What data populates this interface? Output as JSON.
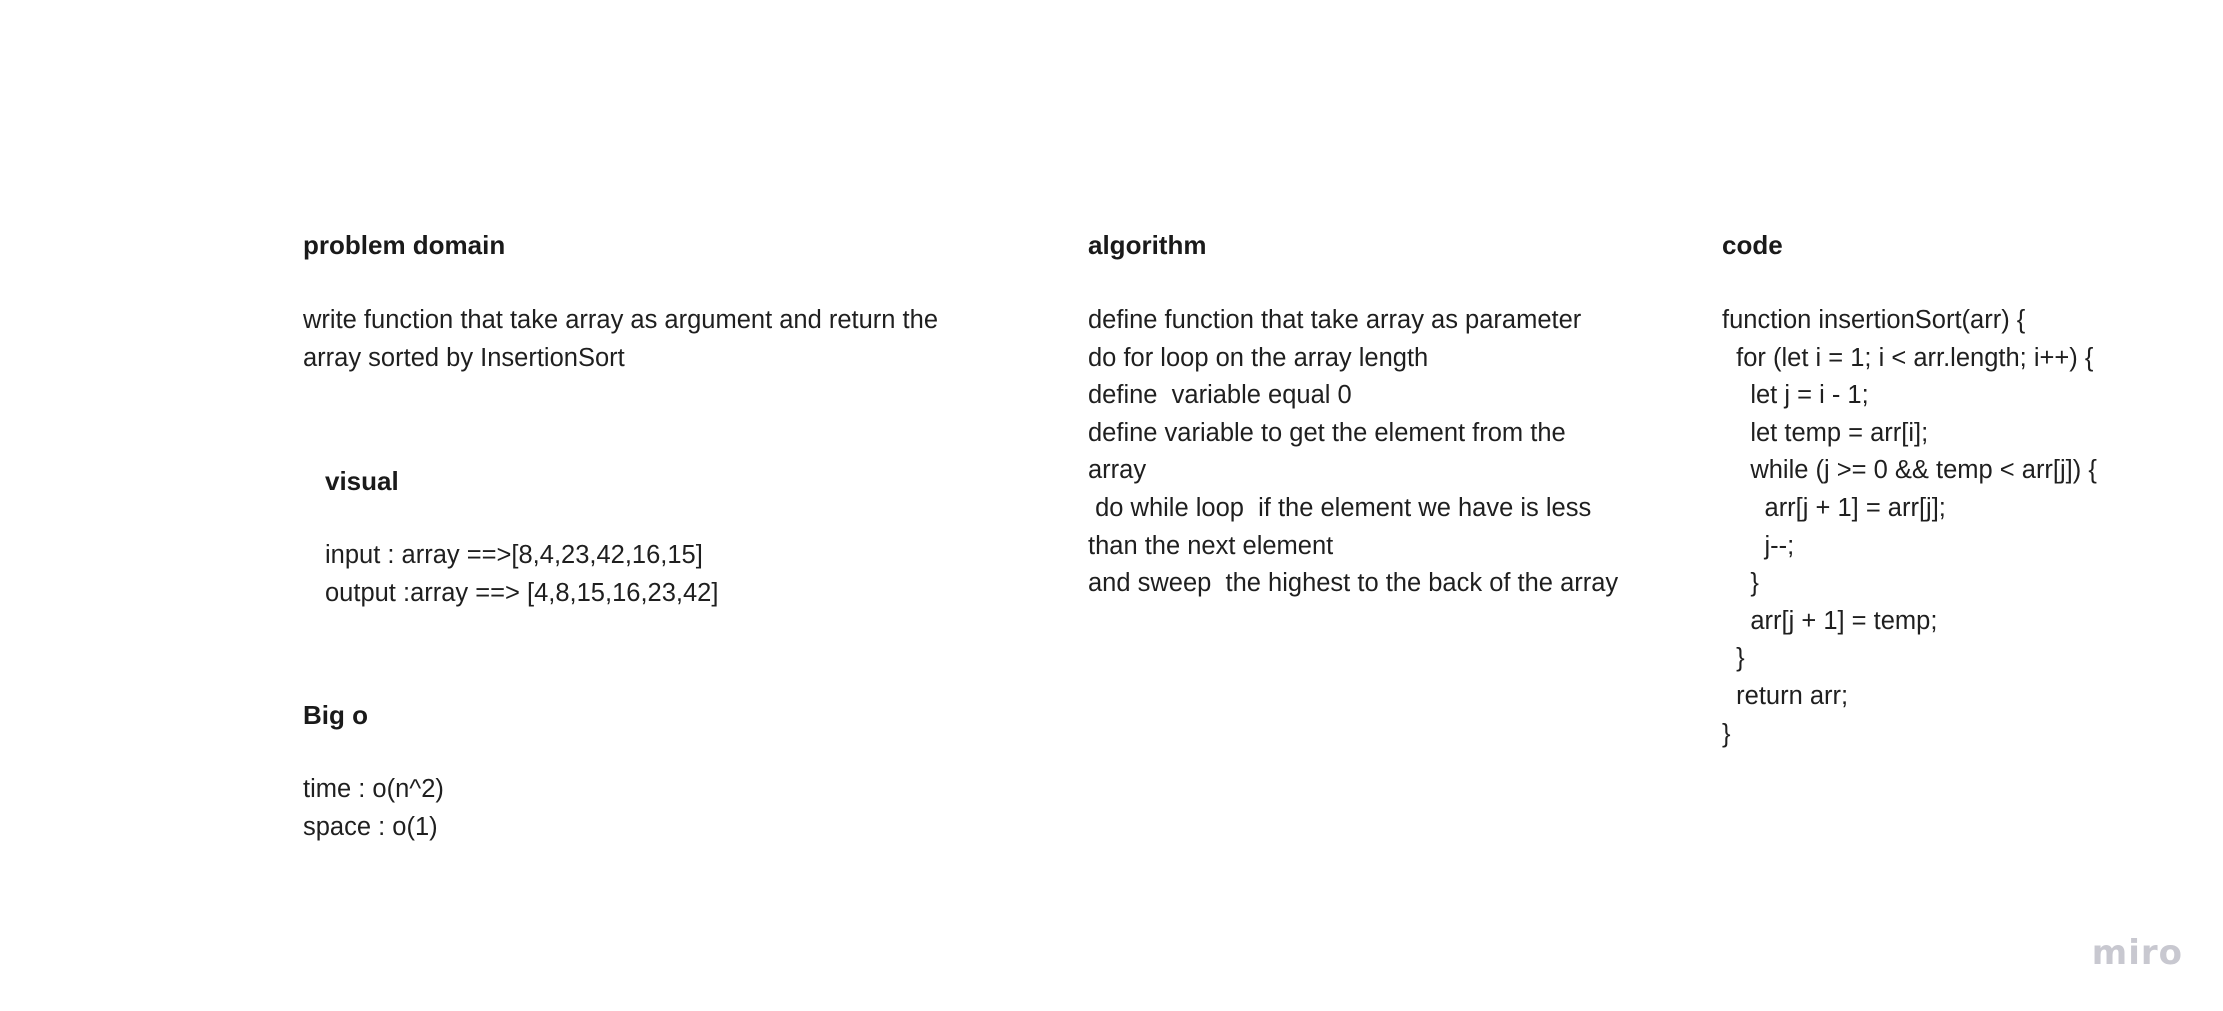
{
  "problem_domain": {
    "title": "problem domain",
    "lines": [
      "write function that take array as argument and return the",
      "array sorted by InsertionSort"
    ]
  },
  "visual": {
    "title": "visual",
    "lines": [
      "input : array ==>[8,4,23,42,16,15]",
      "output :array ==> [4,8,15,16,23,42]"
    ]
  },
  "big_o": {
    "title": "Big o",
    "lines": [
      "time : o(n^2)",
      "space : o(1)"
    ]
  },
  "algorithm": {
    "title": "algorithm",
    "lines": [
      "define function that take array as parameter",
      "do for loop on the array length",
      "define  variable equal 0",
      "define variable to get the element from the",
      "array",
      " do while loop  if the element we have is less",
      "than the next element",
      "and sweep  the highest to the back of the array"
    ]
  },
  "code": {
    "title": "code",
    "lines": [
      "function insertionSort(arr) {",
      "  for (let i = 1; i < arr.length; i++) {",
      "    let j = i - 1;",
      "    let temp = arr[i];",
      "    while (j >= 0 && temp < arr[j]) {",
      "      arr[j + 1] = arr[j];",
      "      j--;",
      "    }",
      "    arr[j + 1] = temp;",
      "  }",
      "  return arr;",
      "}"
    ]
  },
  "watermark": {
    "label": "miro"
  }
}
